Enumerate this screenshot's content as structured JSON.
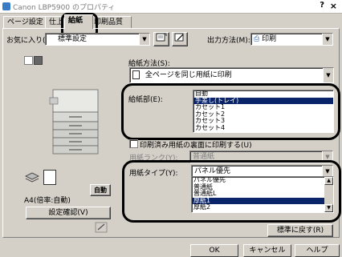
{
  "window": {
    "title": "Canon LBP5900 のプロパティ",
    "help": "?",
    "close": "×"
  },
  "tabs": [
    {
      "label": "ページ設定"
    },
    {
      "label": "仕上"
    },
    {
      "label": "給紙"
    },
    {
      "label": "印刷品質"
    }
  ],
  "toolbar": {
    "favorites_label": "お気に入り(F):",
    "favorites_value": "標準設定",
    "output_method_label": "出力方法(M):",
    "output_method_value": "印刷"
  },
  "paper_source_method": {
    "label": "給紙方法(S):",
    "value": "全ページを同じ用紙に印刷"
  },
  "paper_source": {
    "label": "給紙部(E):",
    "items": [
      "自動",
      "手差し(トレイ)",
      "カセット1",
      "カセット2",
      "カセット3",
      "カセット4"
    ],
    "selected_index": 1
  },
  "back_print": {
    "label": "印刷済み用紙の裏面に印刷する(U)",
    "sub_label": "用紙ランク(Y):",
    "sub_value": "普通紙"
  },
  "paper_type": {
    "label": "用紙タイプ(Y):",
    "value": "パネル優先",
    "items": [
      "パネル優先",
      "普通紙",
      "普通紙L",
      "厚紙1",
      "厚紙2"
    ],
    "selected_index": 3
  },
  "left_panel": {
    "auto_label": "自動",
    "paper_info": "A4(倍率:自動)",
    "settings_button": "設定確認(V)"
  },
  "buttons": {
    "restore_defaults": "標準に戻す(R)",
    "ok": "OK",
    "cancel": "キャンセル",
    "help": "ヘルプ"
  }
}
